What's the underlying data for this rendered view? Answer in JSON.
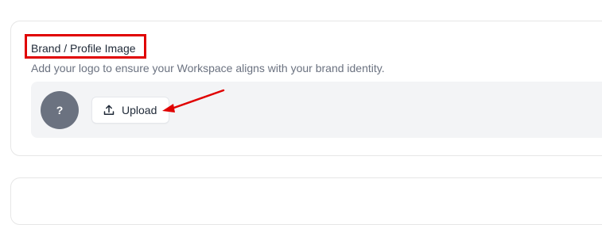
{
  "brand_section": {
    "title": "Brand / Profile Image",
    "description": "Add your logo to ensure your Workspace aligns with your brand identity.",
    "avatar_placeholder": "?",
    "upload_label": "Upload",
    "upload_icon": "upload-icon"
  },
  "annotations": {
    "highlight_color": "#e00000",
    "arrow_color": "#e00000"
  }
}
